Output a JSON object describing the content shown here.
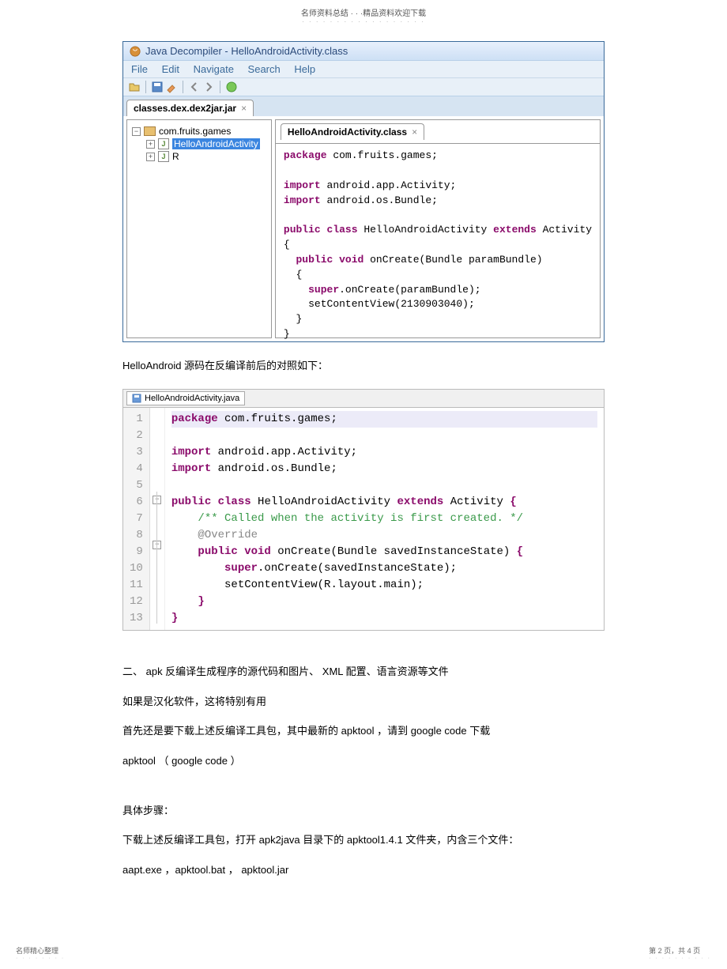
{
  "header": {
    "line1": "名师资料总结 · · ·精品资料欢迎下载"
  },
  "decompiler": {
    "title": "Java Decompiler - HelloAndroidActivity.class",
    "menu": [
      "File",
      "Edit",
      "Navigate",
      "Search",
      "Help"
    ],
    "jarTab": "classes.dex.dex2jar.jar",
    "tree": {
      "pkg": "com.fruits.games",
      "items": [
        "HelloAndroidActivity",
        "R"
      ]
    },
    "codeTab": "HelloAndroidActivity.class",
    "code": {
      "l1a": "package",
      "l1b": " com.fruits.games;",
      "l2a": "import",
      "l2b": " android.app.Activity;",
      "l3a": "import",
      "l3b": " android.os.Bundle;",
      "l4a": "public class",
      "l4b": " HelloAndroidActivity ",
      "l4c": "extends",
      "l4d": " Activity",
      "l5": "{",
      "l6a": "  public void",
      "l6b": " onCreate(Bundle paramBundle)",
      "l7": "  {",
      "l8a": "    super",
      "l8b": ".onCreate(paramBundle);",
      "l9": "    setContentView(2130903040);",
      "l10": "  }",
      "l11": "}"
    }
  },
  "text1": "HelloAndroid   源码在反编译前后的对照如下：",
  "editor2": {
    "tab": "HelloAndroidActivity.java",
    "lines": {
      "n1": "1",
      "n2": "2",
      "n3": "3",
      "n4": "4",
      "n5": "5",
      "n6": "6",
      "n7": "7",
      "n8": "8",
      "n9": "9",
      "n10": "10",
      "n11": "11",
      "n12": "12",
      "n13": "13",
      "c1a": "package",
      "c1b": " com.fruits.games;",
      "c3a": "import",
      "c3b": " android.app.Activity;",
      "c4a": "import",
      "c4b": " android.os.Bundle;",
      "c6a": "public class",
      "c6b": " HelloAndroidActivity ",
      "c6c": "extends",
      "c6d": " Activity ",
      "c6e": "{",
      "c7": "    /** Called when the activity is first created. */",
      "c8": "    @Override",
      "c9a": "    public void",
      "c9b": " onCreate(Bundle savedInstanceState) ",
      "c9c": "{",
      "c10a": "        super",
      "c10b": ".onCreate(savedInstanceState);",
      "c11": "        setContentView(R.layout.main);",
      "c12": "    }",
      "c13": "}"
    }
  },
  "para": {
    "p1": "二、 apk  反编译生成程序的源代码和图片、      XML  配置、语言资源等文件",
    "p2": "如果是汉化软件，这将特别有用",
    "p3": "首先还是要下载上述反编译工具包，其中最新的        apktool  ，请到   google code   下载",
    "p4": "apktool （ google code   ）",
    "p5": "具体步骤：",
    "p6": "下载上述反编译工具包，打开      apk2java  目录下的   apktool1.4.1   文件夹，内含三个文件：",
    "p7": "aapt.exe  ，apktool.bat  ， apktool.jar"
  },
  "footer": {
    "left": "名师精心整理",
    "right": "第 2 页，共 4 页"
  }
}
